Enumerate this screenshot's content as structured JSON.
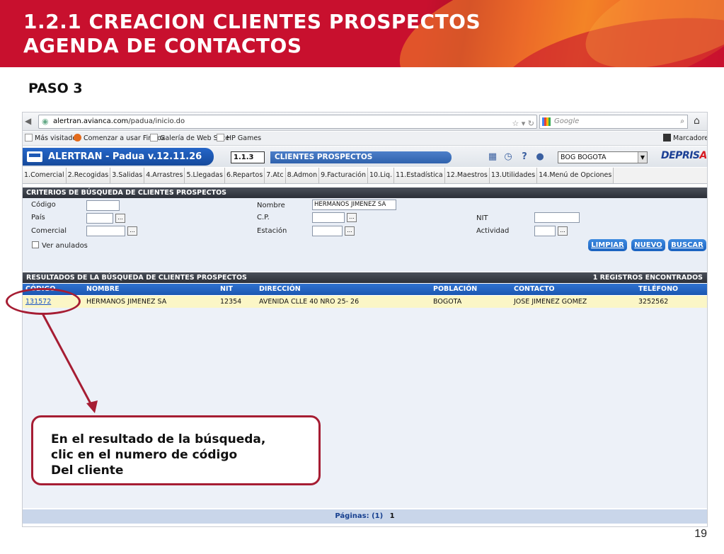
{
  "slide": {
    "title_line1": "1.2.1 CREACION CLIENTES PROSPECTOS",
    "title_line2": "AGENDA DE CONTACTOS",
    "step": "PASO 3",
    "page_number": "19",
    "callout_lines": [
      "En el resultado de la búsqueda,",
      "clic en el numero de código",
      "Del cliente"
    ]
  },
  "browser": {
    "url_host": "alertran.avianca.com",
    "url_path": "/padua/inicio.do",
    "search_placeholder": "Google",
    "bookmarks": [
      "Más visitados",
      "Comenzar a usar Firefox",
      "Galería de Web Slice",
      "HP Games"
    ],
    "bookmarks_menu": "Marcadores"
  },
  "app": {
    "title": "ALERTRAN - Padua  v.12.11.26",
    "menu_code": "1.1.3",
    "menu_title": "CLIENTES PROSPECTOS",
    "office": "BOG BOGOTA",
    "brand": "DEPRIS",
    "brand_accent": "A",
    "tabs": [
      "1.Comercial",
      "2.Recogidas",
      "3.Salidas",
      "4.Arrastres",
      "5.Llegadas",
      "6.Repartos",
      "7.Atc",
      "8.Admon",
      "9.Facturación",
      "10.Liq.",
      "11.Estadística",
      "12.Maestros",
      "13.Utilidades",
      "14.Menú de Opciones"
    ]
  },
  "criteria": {
    "title": "CRITERIOS DE BÚSQUEDA DE CLIENTES PROSPECTOS",
    "codigo_label": "Código",
    "codigo_value": "",
    "pais_label": "País",
    "pais_value": "",
    "comercial_label": "Comercial",
    "comercial_value": "",
    "nombre_label": "Nombre",
    "nombre_value": "HERMANOS JIMENEZ SA",
    "cp_label": "C.P.",
    "cp_value": "",
    "estacion_label": "Estación",
    "estacion_value": "",
    "nit_label": "NIT",
    "nit_value": "",
    "actividad_label": "Actividad",
    "actividad_value": "",
    "ver_anulados_label": "Ver anulados",
    "lookup_label": "...",
    "buttons": {
      "limpiar": "LIMPIAR",
      "nuevo": "NUEVO",
      "buscar": "BUSCAR"
    }
  },
  "results": {
    "title": "RESULTADOS DE LA BÚSQUEDA DE CLIENTES PROSPECTOS",
    "count": "1 REGISTROS ENCONTRADOS",
    "columns": [
      "CÓDIGO",
      "NOMBRE",
      "NIT",
      "DIRECCIÓN",
      "POBLACIÓN",
      "CONTACTO",
      "TELÉFONO"
    ],
    "rows": [
      [
        "131572",
        "HERMANOS JIMENEZ SA",
        "12354",
        "AVENIDA  CLLE 40 NRO 25- 26",
        "BOGOTA",
        "JOSE JIMENEZ GOMEZ",
        "3252562"
      ]
    ],
    "pages_label": "Páginas: (1)",
    "current_page": "1"
  },
  "colors": {
    "banner_red": "#c8102e",
    "banner_orange": "#f07a24",
    "annotation": "#a61d33",
    "app_blue": "#1d58b5",
    "row_highlight": "#fbf6c6"
  }
}
